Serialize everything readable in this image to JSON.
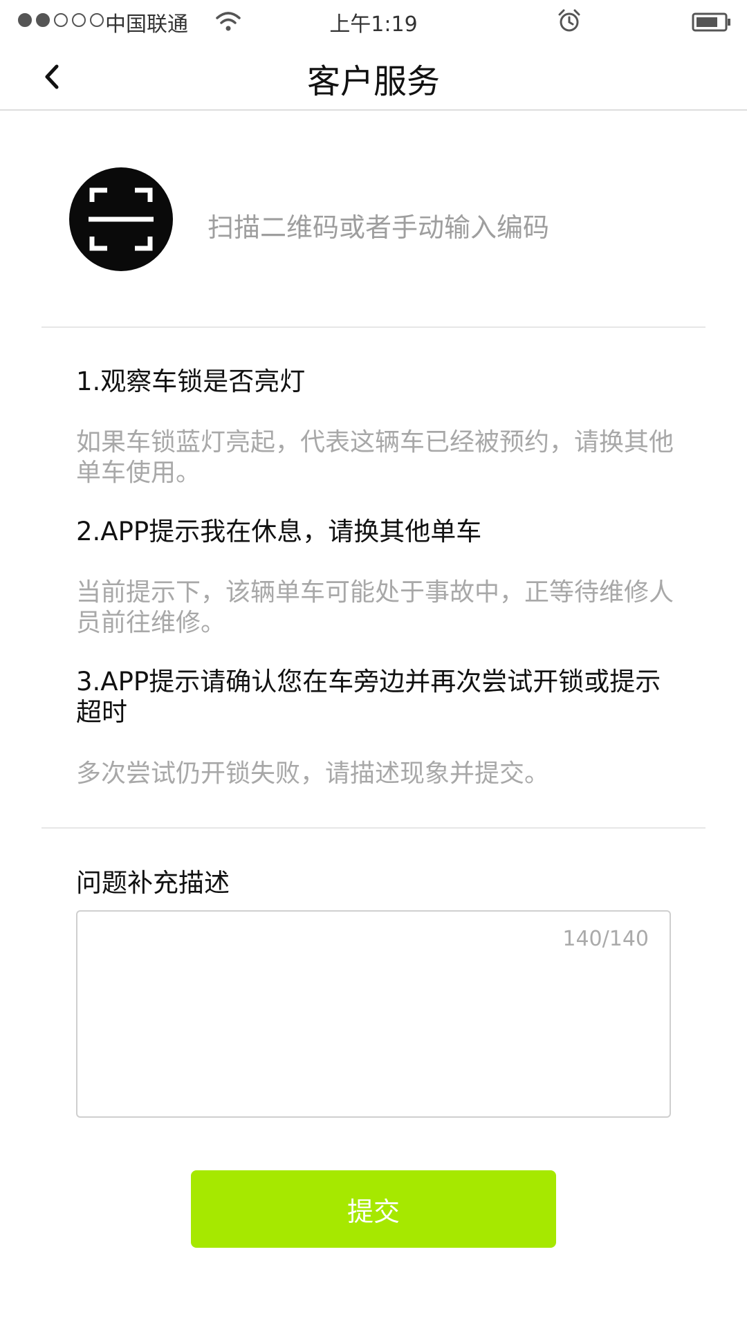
{
  "status_bar": {
    "signal_dots_filled": 2,
    "signal_dots_total": 5,
    "carrier": "中国联通",
    "time": "上午1:19",
    "icons": [
      "wifi-icon",
      "alarm-icon",
      "battery-icon"
    ]
  },
  "header": {
    "back_icon": "chevron-left-icon",
    "title": "客户服务"
  },
  "scan": {
    "icon": "scan-qr-icon",
    "hint": "扫描二维码或者手动输入编码"
  },
  "tips": [
    {
      "title": "1.观察车锁是否亮灯",
      "desc": "如果车锁蓝灯亮起，代表这辆车已经被预约，请换其他单车使用。"
    },
    {
      "title": "2.APP提示我在休息，请换其他单车",
      "desc": "当前提示下，该辆单车可能处于事故中，正等待维修人员前往维修。"
    },
    {
      "title": "3.APP提示请确认您在车旁边并再次尝试开锁或提示超时",
      "desc": "多次尝试仍开锁失败，请描述现象并提交。"
    }
  ],
  "supplement": {
    "label": "问题补充描述",
    "value": "",
    "counter": "140/140"
  },
  "submit": {
    "label": "提交"
  },
  "colors": {
    "accent": "#a6e800",
    "muted_text": "#a8a8a8",
    "scan_bg": "#0a0a0a"
  }
}
